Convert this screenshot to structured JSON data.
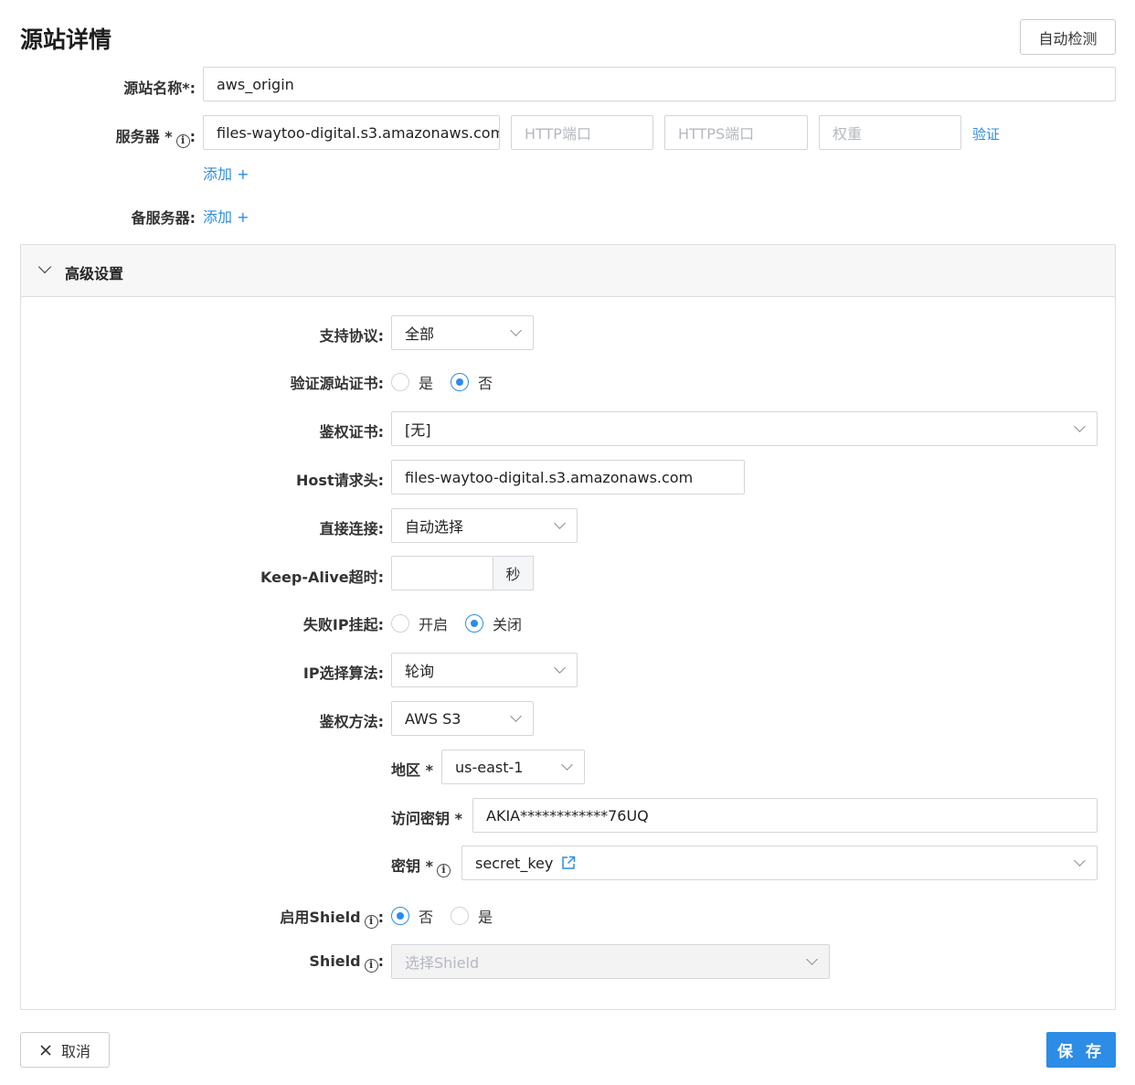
{
  "page_title": "源站详情",
  "auto_detect_label": "自动检测",
  "origin_name": {
    "label": "源站名称*:",
    "value": "aws_origin"
  },
  "server": {
    "label": "服务器 *",
    "colon": ":",
    "host_value": "files-waytoo-digital.s3.amazonaws.com",
    "http_port_placeholder": "HTTP端口",
    "https_port_placeholder": "HTTPS端口",
    "weight_placeholder": "权重",
    "verify_label": "验证",
    "add_label": "添加 +"
  },
  "backup_server": {
    "label": "备服务器:",
    "add_label": "添加 +"
  },
  "advanced": {
    "title": "高级设置",
    "protocol": {
      "label": "支持协议:",
      "value": "全部"
    },
    "verify_cert": {
      "label": "验证源站证书:",
      "options": [
        "是",
        "否"
      ],
      "selected": "否"
    },
    "auth_cert": {
      "label": "鉴权证书:",
      "value": "[无]"
    },
    "host_header": {
      "label": "Host请求头:",
      "value": "files-waytoo-digital.s3.amazonaws.com"
    },
    "direct_connect": {
      "label": "直接连接:",
      "value": "自动选择"
    },
    "keepalive": {
      "label": "Keep-Alive超时:",
      "value": "",
      "unit": "秒"
    },
    "fail_ip": {
      "label": "失败IP挂起:",
      "options": [
        "开启",
        "关闭"
      ],
      "selected": "关闭"
    },
    "ip_algorithm": {
      "label": "IP选择算法:",
      "value": "轮询"
    },
    "auth_method": {
      "label": "鉴权方法:",
      "value": "AWS S3"
    },
    "region": {
      "label": "地区 *",
      "value": "us-east-1"
    },
    "access_key": {
      "label": "访问密钥 *",
      "value": "AKIA************76UQ"
    },
    "secret": {
      "label": "密钥 *",
      "value": "secret_key"
    },
    "shield_enable": {
      "label": "启用Shield",
      "options": [
        "否",
        "是"
      ],
      "selected": "否"
    },
    "shield": {
      "label": "Shield",
      "placeholder": "选择Shield"
    }
  },
  "cancel_label": "取消",
  "save_label": "保 存",
  "colors": {
    "accent": "#2d8ce6",
    "border": "#d3d6db"
  },
  "icons": [
    "info-icon",
    "chevron-down-icon",
    "external-link-icon",
    "close-icon"
  ]
}
